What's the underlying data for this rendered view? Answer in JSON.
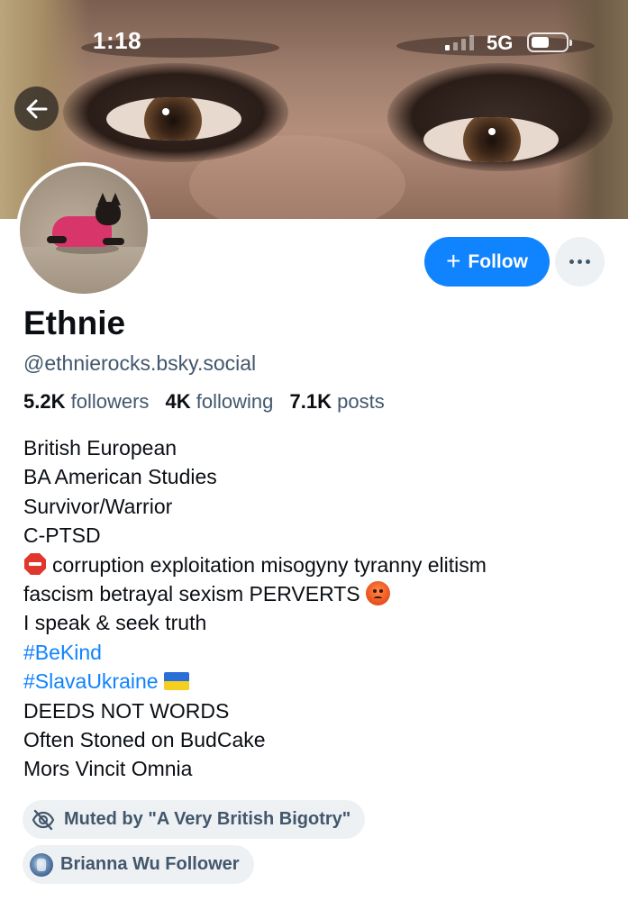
{
  "status_bar": {
    "time": "1:18",
    "network": "5G"
  },
  "profile": {
    "display_name": "Ethnie",
    "handle": "@ethnierocks.bsky.social",
    "stats": {
      "followers_count": "5.2K",
      "followers_label": "followers",
      "following_count": "4K",
      "following_label": "following",
      "posts_count": "7.1K",
      "posts_label": "posts"
    },
    "bio": {
      "line1": "British European",
      "line2": "BA American Studies",
      "line3": "Survivor/Warrior",
      "line4": "C-PTSD",
      "line5": "corruption exploitation misogyny tyranny elitism",
      "line6": "fascism betrayal sexism PERVERTS",
      "line7": "I speak & seek truth",
      "line8": "#BeKind",
      "line9": "#SlavaUkraine",
      "line10": "DEEDS NOT WORDS",
      "line11": "Often Stoned on BudCake",
      "line12": "Mors Vincit Omnia"
    }
  },
  "actions": {
    "follow_label": "Follow"
  },
  "labels": {
    "muted": "Muted by \"A Very British Bigotry\"",
    "list": "Brianna Wu Follower"
  },
  "icons": [
    "back-arrow-icon",
    "stop-sign-icon",
    "angry-face-icon",
    "ukraine-flag-icon",
    "eye-off-icon",
    "more-icon",
    "plus-icon"
  ],
  "colors": {
    "accent": "#1083fe",
    "secondary_text": "#42576c",
    "pill_bg": "#eef1f4",
    "text": "#0b0f14"
  }
}
